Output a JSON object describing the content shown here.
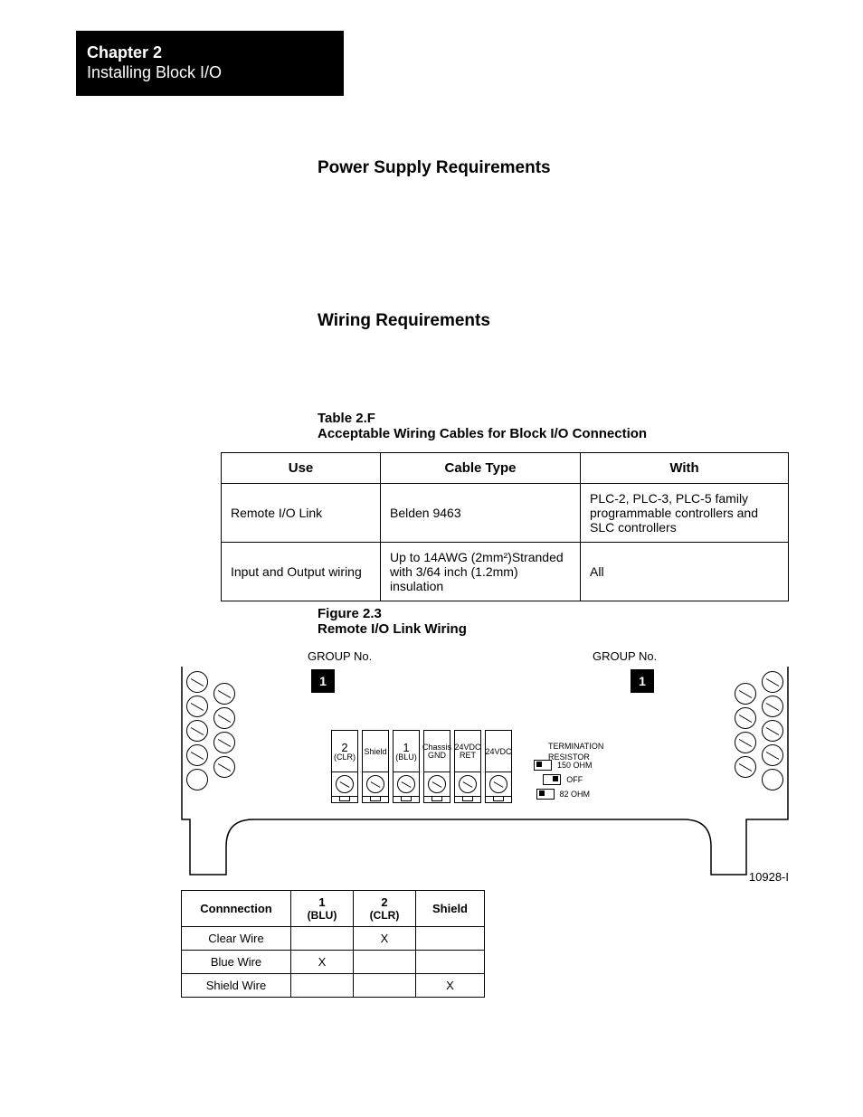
{
  "chapter": {
    "title": "Chapter 2",
    "subtitle": "Installing Block I/O"
  },
  "headings": {
    "power": "Power Supply Requirements",
    "wiring": "Wiring Requirements"
  },
  "table2f": {
    "caption_line1": "Table 2.F",
    "caption_line2": "Acceptable Wiring Cables for Block I/O Connection",
    "headers": {
      "use": "Use",
      "cable": "Cable Type",
      "with": "With"
    },
    "rows": [
      {
        "use": "Remote I/O Link",
        "cable": "Belden 9463",
        "with": "PLC-2, PLC-3, PLC-5 family programmable controllers and SLC controllers"
      },
      {
        "use": "Input and Output wiring",
        "cable": "Up to 14AWG (2mm²)Stranded with 3/64 inch (1.2mm) insulation",
        "with": "All"
      }
    ]
  },
  "figure23": {
    "caption_line1": "Figure 2.3",
    "caption_line2": "Remote I/O Link Wiring",
    "group_label": "GROUP No.",
    "group_num": "1",
    "connectors": [
      {
        "top": "2",
        "bottom": "(CLR)"
      },
      {
        "top": "Shield",
        "bottom": ""
      },
      {
        "top": "1",
        "bottom": "(BLU)"
      },
      {
        "top": "Chassis",
        "bottom": "GND"
      },
      {
        "top": "24VDC",
        "bottom": "RET"
      },
      {
        "top": "24VDC",
        "bottom": ""
      }
    ],
    "termination": {
      "title1": "TERMINATION",
      "title2": "RESISTOR",
      "opt1": "150 OHM",
      "opt2": "OFF",
      "opt3": "82 OHM"
    },
    "id": "10928-I"
  },
  "conn_table": {
    "headers": {
      "conn": "Connnection",
      "c1a": "1",
      "c1b": "(BLU)",
      "c2a": "2",
      "c2b": "(CLR)",
      "shield": "Shield"
    },
    "rows": [
      {
        "label": "Clear Wire",
        "c1": "",
        "c2": "X",
        "shield": ""
      },
      {
        "label": "Blue Wire",
        "c1": "X",
        "c2": "",
        "shield": ""
      },
      {
        "label": "Shield Wire",
        "c1": "",
        "c2": "",
        "shield": "X"
      }
    ]
  }
}
